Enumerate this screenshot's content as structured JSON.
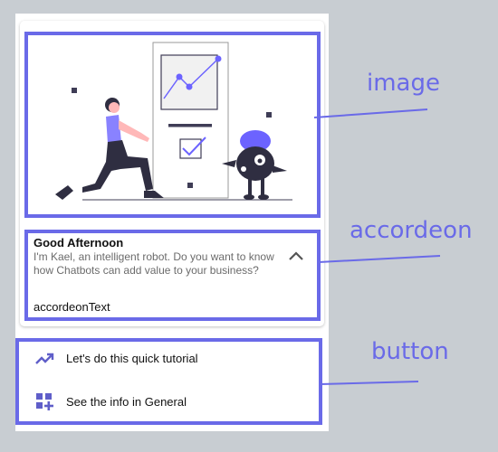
{
  "accordion": {
    "title": "Good Afternoon",
    "description": "I'm Kael, an intelligent robot. Do you want to know how Chatbots can add value to your business?",
    "content_label": "accordeonText",
    "toggle_icon": "chevron-up-icon"
  },
  "buttons": [
    {
      "label": "Let's do this quick tutorial",
      "icon": "trending-up-icon"
    },
    {
      "label": "See the info in General",
      "icon": "dashboard-add-icon"
    }
  ],
  "annotations": {
    "image": "image",
    "accordion": "accordeon",
    "button": "button"
  },
  "colors": {
    "accent": "#6a6ae8",
    "background": "#c8cdd2",
    "card": "#ffffff",
    "illustration_purple": "#6c63ff"
  }
}
